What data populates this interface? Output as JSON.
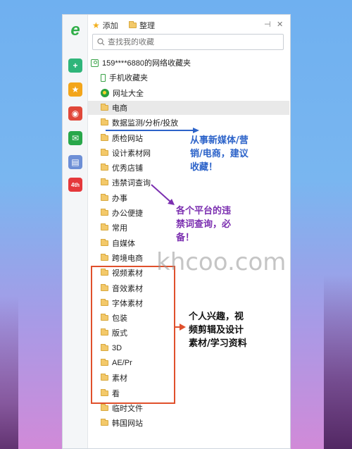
{
  "toolbar": {
    "add_label": "添加",
    "organize_label": "整理",
    "pin_glyph": "⊣",
    "close_glyph": "✕"
  },
  "search": {
    "placeholder": "查找我的收藏"
  },
  "rail": {
    "logo_glyph": "e",
    "items": [
      {
        "name": "plus-app-icon",
        "glyph": "+",
        "color": "#2fb57a"
      },
      {
        "name": "star-app-icon",
        "glyph": "★",
        "color": "#f3a51a"
      },
      {
        "name": "weibo-app-icon",
        "glyph": "◉",
        "color": "#e0483a"
      },
      {
        "name": "mail-app-icon",
        "glyph": "✉",
        "color": "#28a74a"
      },
      {
        "name": "doc-app-icon",
        "glyph": "▤",
        "color": "#6d8fd6"
      },
      {
        "name": "game-app-icon",
        "glyph": "4th",
        "color": "#e5383b"
      }
    ]
  },
  "account": {
    "label": "159****6880的网络收藏夹"
  },
  "special_items": [
    {
      "label": "手机收藏夹",
      "icon": "phone"
    },
    {
      "label": "网址大全",
      "icon": "nav"
    }
  ],
  "folders": [
    {
      "label": "电商",
      "selected": true
    },
    {
      "label": "数据监测/分析/投放",
      "selected": false
    },
    {
      "label": "质检网站",
      "selected": false
    },
    {
      "label": "设计素材网",
      "selected": false
    },
    {
      "label": "优秀店铺",
      "selected": false
    },
    {
      "label": "违禁词查询",
      "selected": false
    },
    {
      "label": "办事",
      "selected": false
    },
    {
      "label": "办公便捷",
      "selected": false
    },
    {
      "label": "常用",
      "selected": false
    },
    {
      "label": "自媒体",
      "selected": false
    },
    {
      "label": "跨境电商",
      "selected": false
    },
    {
      "label": "视频素材",
      "selected": false
    },
    {
      "label": "音效素材",
      "selected": false
    },
    {
      "label": "字体素材",
      "selected": false
    },
    {
      "label": "包装",
      "selected": false
    },
    {
      "label": "版式",
      "selected": false
    },
    {
      "label": "3D",
      "selected": false
    },
    {
      "label": "AE/Pr",
      "selected": false
    },
    {
      "label": "素材",
      "selected": false
    },
    {
      "label": "看",
      "selected": false
    },
    {
      "label": "临时文件",
      "selected": false
    },
    {
      "label": "韩国网站",
      "selected": false
    }
  ],
  "annotations": {
    "blue": [
      "从事新媒体/营",
      "销/电商，建议",
      "收藏！"
    ],
    "purple": [
      "各个平台的违",
      "禁词查询，必",
      "备！"
    ],
    "black": [
      "个人兴趣，视",
      "频剪辑及设计",
      "素材/学习资料"
    ],
    "colors": {
      "blue": "#2c63c9",
      "purple": "#7b2fb0",
      "red": "#e0502c"
    }
  },
  "watermark": "khcoo.com"
}
